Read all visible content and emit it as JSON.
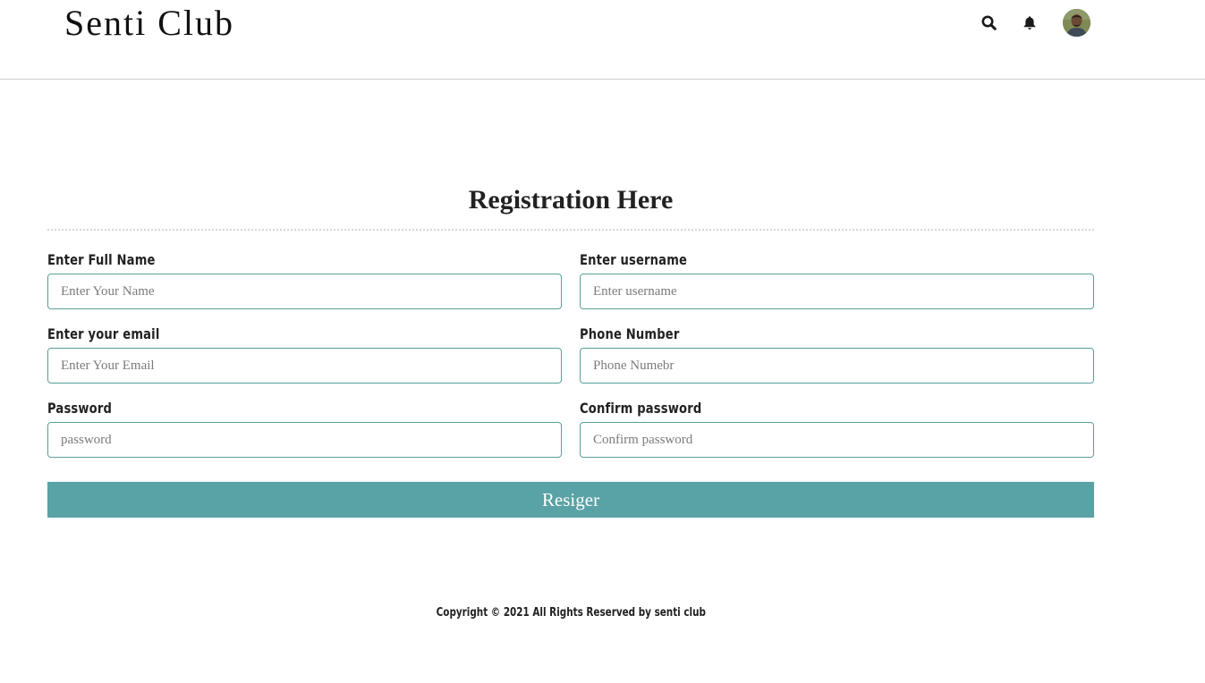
{
  "header": {
    "brand": "Senti Club",
    "icons": [
      "search-icon",
      "bell-icon",
      "avatar"
    ]
  },
  "form": {
    "title": "Registration Here",
    "fields": [
      {
        "label": "Enter Full Name",
        "placeholder": "Enter Your Name",
        "value": ""
      },
      {
        "label": "Enter username",
        "placeholder": "Enter username",
        "value": ""
      },
      {
        "label": "Enter your email",
        "placeholder": "Enter Your Email",
        "value": ""
      },
      {
        "label": "Phone Number",
        "placeholder": "Phone Numebr",
        "value": ""
      },
      {
        "label": "Password",
        "placeholder": "password",
        "value": ""
      },
      {
        "label": "Confirm password",
        "placeholder": "Confirm password",
        "value": ""
      }
    ],
    "submit_label": "Resiger"
  },
  "footer": {
    "text": "Copyright © 2021 All Rights Reserved by senti club"
  },
  "colors": {
    "accent": "#59a2a5",
    "input_border": "#5a9e9a"
  }
}
